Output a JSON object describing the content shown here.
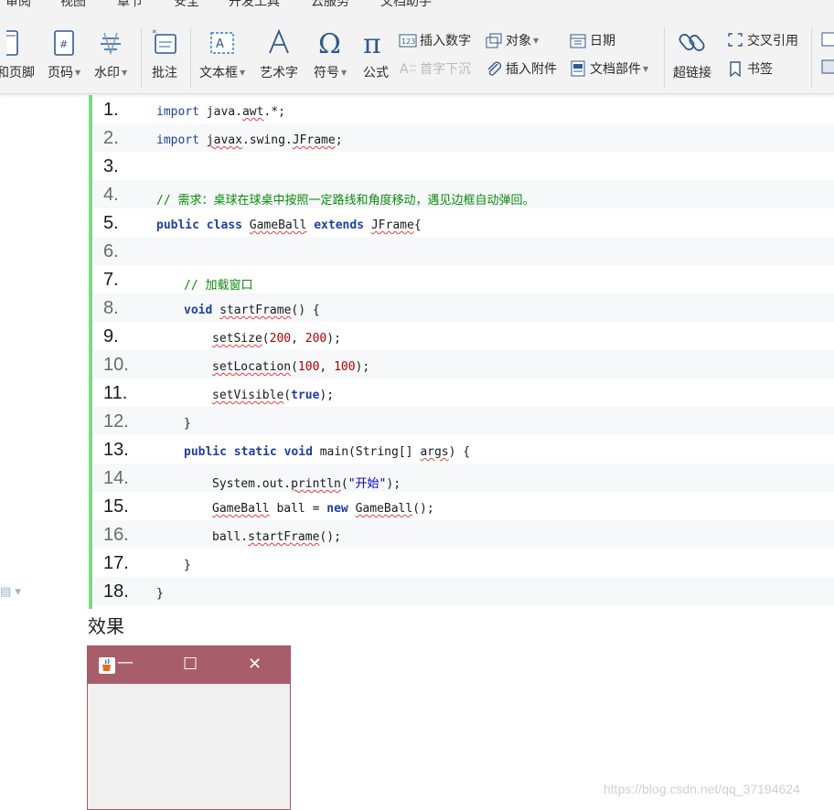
{
  "menu": [
    "审阅",
    "视图",
    "章节",
    "安全",
    "开发工具",
    "云服务",
    "文档助手"
  ],
  "ribbon": {
    "header_footer": "和页脚",
    "page_number": "页码",
    "watermark": "水印",
    "comment": "批注",
    "textbox": "文本框",
    "wordart": "艺术字",
    "symbol": "符号",
    "formula": "公式",
    "insert_number": "插入数字",
    "drop_cap": "首字下沉",
    "object": "对象",
    "insert_attachment": "插入附件",
    "date": "日期",
    "doc_parts": "文档部件",
    "hyperlink": "超链接",
    "cross_reference": "交叉引用",
    "bookmark": "书签"
  },
  "code_lines": [
    {
      "n": "1."
    },
    {
      "n": "2."
    },
    {
      "n": "3."
    },
    {
      "n": "4."
    },
    {
      "n": "5."
    },
    {
      "n": "6."
    },
    {
      "n": "7."
    },
    {
      "n": "8."
    },
    {
      "n": "9."
    },
    {
      "n": "10."
    },
    {
      "n": "11."
    },
    {
      "n": "12."
    },
    {
      "n": "13."
    },
    {
      "n": "14."
    },
    {
      "n": "15."
    },
    {
      "n": "16."
    },
    {
      "n": "17."
    },
    {
      "n": "18."
    }
  ],
  "code": {
    "l1_kw": "import",
    "l1_a": " java.",
    "l1_b": "awt",
    "l1_c": ".*;",
    "l2_kw": "import",
    "l2_a": " ",
    "l2_b": "javax",
    "l2_c": ".swing.",
    "l2_d": "JFrame",
    "l2_e": ";",
    "l4": "// 需求：桌球在球桌中按照一定路线和角度移动，遇见边框自动弹回。",
    "l5_kw1": "public",
    "l5_kw2": "class",
    "l5_name": "GameBall",
    "l5_kw3": "extends",
    "l5_super": "JFrame",
    "l5_end": "{",
    "l7": "// 加载窗口",
    "l8_kw": "void",
    "l8_name": "startFrame",
    "l8_end": "() {",
    "l9_fn": "setSize",
    "l9_a": "(",
    "l9_n1": "200",
    "l9_b": ", ",
    "l9_n2": "200",
    "l9_c": ");",
    "l10_fn": "setLocation",
    "l10_a": "(",
    "l10_n1": "100",
    "l10_b": ", ",
    "l10_n2": "100",
    "l10_c": ");",
    "l11_fn": "setVisible",
    "l11_a": "(",
    "l11_kw": "true",
    "l11_c": ");",
    "l12": "}",
    "l13_kw1": "public",
    "l13_kw2": "static",
    "l13_kw3": "void",
    "l13_a": " main(String[] ",
    "l13_args": "args",
    "l13_b": ") {",
    "l14_a": "System.out.",
    "l14_fn": "println",
    "l14_b": "(",
    "l14_str": "\"开始\"",
    "l14_c": ");",
    "l15_cls": "GameBall",
    "l15_a": " ball = ",
    "l15_kw": "new",
    "l15_b": " ",
    "l15_cls2": "GameBall",
    "l15_c": "();",
    "l16_a": "ball.",
    "l16_fn": "startFrame",
    "l16_b": "();",
    "l17": "}",
    "l18": "}"
  },
  "effect_label": "效果",
  "java_window": {
    "minimize": "—",
    "maximize": "☐",
    "close": "✕"
  },
  "watermark": "https://blog.csdn.net/qq_37194624",
  "colors": {
    "title_bar": "#a85d6b",
    "code_border": "#7ed97e",
    "keyword": "#1f3f9f",
    "comment": "#0a8a0a",
    "number": "#b00000",
    "string": "#0000c8"
  }
}
